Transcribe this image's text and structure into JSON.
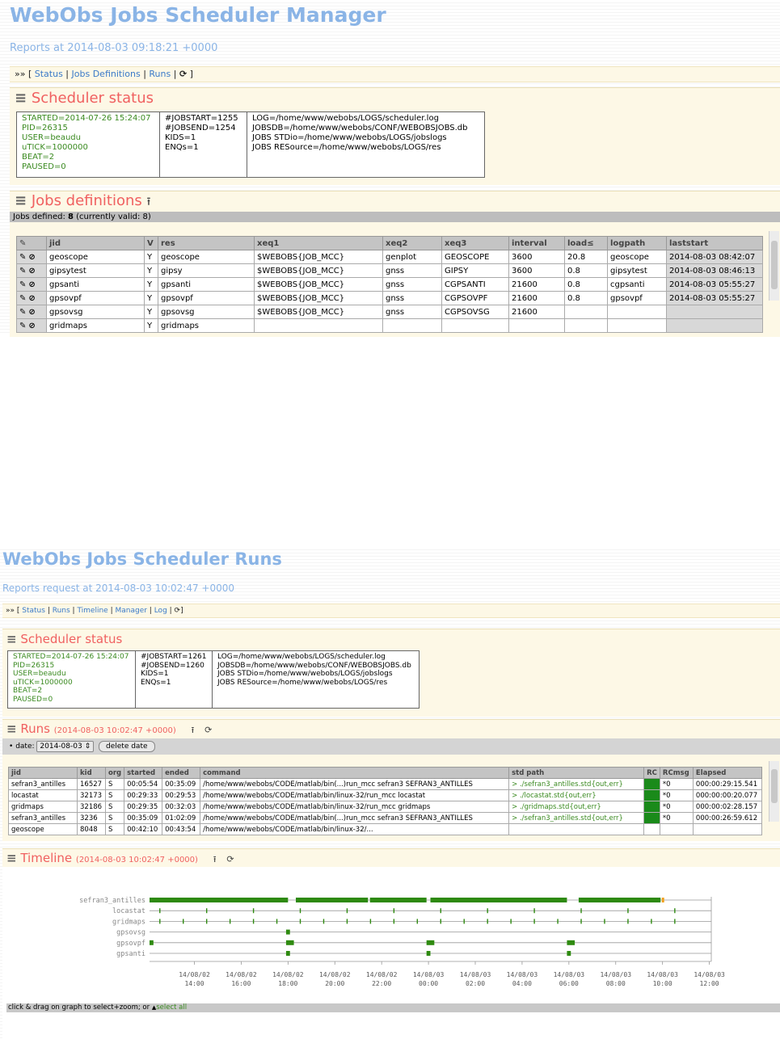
{
  "manager": {
    "title": "WebObs Jobs Scheduler Manager",
    "subtitle": "Reports at 2014-08-03 09:18:21 +0000",
    "nav": {
      "prefix": "»» [",
      "links": [
        "Status",
        "Jobs Definitions",
        "Runs"
      ],
      "suffix": "]"
    },
    "status": {
      "title": "Scheduler status",
      "col1": "STARTED=2014-07-26 15:24:07\nPID=26315\nUSER=beaudu\nuTICK=1000000\nBEAT=2\nPAUSED=0",
      "col2": "#JOBSTART=1255\n#JOBSEND=1254\nKIDS=1\nENQs=1",
      "col3": "LOG=/home/www/webobs/LOGS/scheduler.log\nJOBSDB=/home/www/webobs/CONF/WEBOBSJOBS.db\nJOBS STDio=/home/www/webobs/LOGS/jobslogs\nJOBS RESource=/home/www/webobs/LOGS/res"
    },
    "jobs": {
      "title": "Jobs definitions",
      "defined_prefix": "Jobs defined:",
      "defined_count": "8",
      "defined_suffix": "(currently valid: 8)",
      "columns": [
        "",
        "jid",
        "V",
        "res",
        "xeq1",
        "xeq2",
        "xeq3",
        "interval",
        "load≤",
        "logpath",
        "laststart"
      ],
      "rows": [
        [
          "geoscope",
          "Y",
          "geoscope",
          "$WEBOBS{JOB_MCC}",
          "genplot",
          "GEOSCOPE",
          "3600",
          "20.8",
          "geoscope",
          "2014-08-03 08:42:07"
        ],
        [
          "gipsytest",
          "Y",
          "gipsy",
          "$WEBOBS{JOB_MCC}",
          "gnss",
          "GIPSY",
          "3600",
          "0.8",
          "gipsytest",
          "2014-08-03 08:46:13"
        ],
        [
          "gpsanti",
          "Y",
          "gpsanti",
          "$WEBOBS{JOB_MCC}",
          "gnss",
          "CGPSANTI",
          "21600",
          "0.8",
          "cgpsanti",
          "2014-08-03 05:55:27"
        ],
        [
          "gpsovpf",
          "Y",
          "gpsovpf",
          "$WEBOBS{JOB_MCC}",
          "gnss",
          "CGPSOVPF",
          "21600",
          "0.8",
          "gpsovpf",
          "2014-08-03 05:55:27"
        ],
        [
          "gpsovsg",
          "Y",
          "gpsovsg",
          "$WEBOBS{JOB_MCC}",
          "gnss",
          "CGPSOVSG",
          "21600",
          "",
          "",
          ""
        ],
        [
          "gridmaps",
          "Y",
          "gridmaps",
          "",
          "",
          "",
          "",
          "",
          "",
          ""
        ]
      ]
    }
  },
  "runs": {
    "title": "WebObs Jobs Scheduler Runs",
    "subtitle": "Reports request at 2014-08-03 10:02:47 +0000",
    "nav": {
      "prefix": "»» [",
      "links": [
        "Status",
        "Runs",
        "Timeline",
        "Manager",
        "Log"
      ],
      "suffix": "]"
    },
    "status": {
      "title": "Scheduler status",
      "col1": "STARTED=2014-07-26 15:24:07\nPID=26315\nUSER=beaudu\nuTICK=1000000\nBEAT=2\nPAUSED=0",
      "col2": "#JOBSTART=1261\n#JOBSEND=1260\nKIDS=1\nENQs=1",
      "col3": "LOG=/home/www/webobs/LOGS/scheduler.log\nJOBSDB=/home/www/webobs/CONF/WEBOBSJOBS.db\nJOBS STDio=/home/www/webobs/LOGS/jobslogs\nJOBS RESource=/home/www/webobs/LOGS/res"
    },
    "runs_section": {
      "title": "Runs",
      "stamp": "(2014-08-03 10:02:47 +0000)",
      "date_label": "date:",
      "date_value": "2014-08-03",
      "delete_label": "delete date",
      "columns": [
        "jid",
        "kid",
        "org",
        "started",
        "ended",
        "command",
        "std path",
        "RC",
        "RCmsg",
        "Elapsed"
      ],
      "rows": [
        [
          "sefran3_antilles",
          "16527",
          "S",
          "00:05:54",
          "00:35:09",
          "/home/www/webobs/CODE/matlab/bin(...)run_mcc sefran3 SEFRAN3_ANTILLES",
          "> ./sefran3_antilles.std{out,err}",
          "0",
          "*0",
          "000:00:29:15.541"
        ],
        [
          "locastat",
          "32173",
          "S",
          "00:29:33",
          "00:29:53",
          "/home/www/webobs/CODE/matlab/bin/linux-32/run_mcc locastat",
          "> ./locastat.std{out,err}",
          "0",
          "*0",
          "000:00:00:20.077"
        ],
        [
          "gridmaps",
          "32186",
          "S",
          "00:29:35",
          "00:32:03",
          "/home/www/webobs/CODE/matlab/bin/linux-32/run_mcc gridmaps",
          "> ./gridmaps.std{out,err}",
          "0",
          "*0",
          "000:00:02:28.157"
        ],
        [
          "sefran3_antilles",
          "3236",
          "S",
          "00:35:09",
          "01:02:09",
          "/home/www/webobs/CODE/matlab/bin(...)run_mcc sefran3 SEFRAN3_ANTILLES",
          "> ./sefran3_antilles.std{out,err}",
          "0",
          "*0",
          "000:00:26:59.612"
        ],
        [
          "geoscope",
          "8048",
          "S",
          "00:42:10",
          "00:43:54",
          "/home/www/webobs/CODE/matlab/bin/linux-32/...",
          "",
          "",
          "",
          ""
        ]
      ]
    },
    "timeline": {
      "title": "Timeline",
      "stamp": "(2014-08-03 10:02:47 +0000)",
      "footer_text": "click & drag on graph to select+zoom;  or",
      "footer_link": "select all",
      "colors": {
        "run": "#2e8a10",
        "running": "#f0a020"
      }
    }
  },
  "chart_data": {
    "type": "timeline",
    "title": "",
    "xlabel": "",
    "ylabel": "",
    "x_ticks": [
      "14/08/02 14:00",
      "14/08/02 16:00",
      "14/08/02 18:00",
      "14/08/02 20:00",
      "14/08/02 22:00",
      "14/08/03 00:00",
      "14/08/03 02:00",
      "14/08/03 04:00",
      "14/08/03 06:00",
      "14/08/03 08:00",
      "14/08/03 10:00",
      "14/08/03 12:00"
    ],
    "xlim": [
      "2014-08-02 12:05",
      "2014-08-03 12:05"
    ],
    "series": [
      {
        "name": "sefran3_antilles",
        "intervals": [
          [
            "2014-08-02 12:05",
            "2014-08-02 18:00"
          ],
          [
            "2014-08-02 18:20",
            "2014-08-02 21:25"
          ],
          [
            "2014-08-02 21:30",
            "2014-08-02 23:55"
          ],
          [
            "2014-08-03 00:05",
            "2014-08-03 05:55"
          ],
          [
            "2014-08-03 06:25",
            "2014-08-03 09:55"
          ]
        ],
        "running_at": "2014-08-03 09:58"
      },
      {
        "name": "locastat",
        "ticks_every_hours": 2,
        "start": "2014-08-02 12:30"
      },
      {
        "name": "gridmaps",
        "ticks_every_hours": 1,
        "start": "2014-08-02 12:30"
      },
      {
        "name": "gpsovsg",
        "intervals": [
          [
            "2014-08-02 17:55",
            "2014-08-02 18:05"
          ]
        ]
      },
      {
        "name": "gpsovpf",
        "intervals": [
          [
            "2014-08-02 12:05",
            "2014-08-02 12:15"
          ],
          [
            "2014-08-02 17:55",
            "2014-08-02 18:15"
          ],
          [
            "2014-08-02 23:55",
            "2014-08-03 00:15"
          ],
          [
            "2014-08-03 05:55",
            "2014-08-03 06:15"
          ]
        ]
      },
      {
        "name": "gpsanti",
        "intervals": [
          [
            "2014-08-02 17:55",
            "2014-08-02 18:05"
          ],
          [
            "2014-08-02 23:55",
            "2014-08-03 00:05"
          ],
          [
            "2014-08-03 05:55",
            "2014-08-03 06:05"
          ]
        ]
      }
    ]
  }
}
